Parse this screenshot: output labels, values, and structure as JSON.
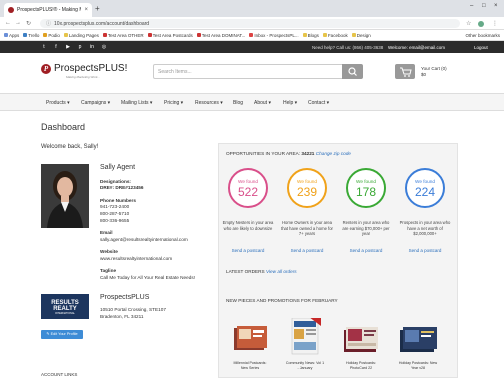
{
  "browser": {
    "tab_title": "ProspectsPLUS!® - Making Mark...",
    "url": "10x.prospectsplus.com/account/dashboard",
    "bookmarks": [
      "Apps",
      "Trello",
      "Podio",
      "Landing Pages",
      "Test Area OTHER",
      "Test Area Postcards",
      "Test Area DOMINAT...",
      "Inbox - ProspectsPL...",
      "Blogs",
      "Facebook",
      "Design"
    ],
    "other_bookmarks": "Other bookmarks"
  },
  "topbar": {
    "help_text": "Need help? Call us: (866) 405-3638",
    "welcome_text": "Welcome: email@email.com",
    "logout_label": "Logout"
  },
  "header": {
    "logo_mark": "P",
    "logo_text": "ProspectsPLUS!",
    "logo_tagline": "Making Marketing Work...",
    "search_placeholder": "Search Items...",
    "cart_label": "Your Cart (0)",
    "cart_total": "$0"
  },
  "nav": {
    "items": [
      "Products",
      "Campaigns",
      "Mailing Lists",
      "Pricing",
      "Resources",
      "Blog",
      "About",
      "Help",
      "Contact"
    ]
  },
  "dashboard": {
    "title": "Dashboard",
    "welcome": "Welcome back, Sally!",
    "agent": {
      "name": "Sally Agent",
      "designations_label": "Designations:",
      "dre": "DRE#: DRE#123456",
      "phone_label": "Phone Numbers",
      "phones": [
        "941-723-2400",
        "800-287-5710",
        "800-336-9655"
      ],
      "email_label": "Email",
      "email": "sally.agent@resultsrealtyinternational.com",
      "website_label": "Website",
      "website": "www.resultsrealtyinternational.com",
      "tagline_label": "Tagline",
      "tagline": "Call Me Today for All Your Real Estate Needs!"
    },
    "company": {
      "logo_text": "RESULTS REALTY",
      "logo_sub": "INTERNATIONAL",
      "edit_label": "Edit Your Profile",
      "name": "ProspectsPLUS",
      "address1": "10510 Portal Crossing, STE107",
      "address2": "Bradenton, FL 34211"
    },
    "account_links": "ACCOUNT LINKS"
  },
  "opportunities": {
    "header": "OPPORTUNITIES IN YOUR AREA:",
    "zip": "34221",
    "change_zip": "Change zip code",
    "cards": [
      {
        "found_label": "We found",
        "count": "522",
        "color": "#d94f8a",
        "desc": "Empty Nesters in your area who are likely to downsize",
        "link": "Send a postcard"
      },
      {
        "found_label": "We found",
        "count": "239",
        "color": "#f0a21a",
        "desc": "Home Owners in your area that have owned a home for 7+ years",
        "link": "Send a postcard"
      },
      {
        "found_label": "We found",
        "count": "178",
        "color": "#3aa935",
        "desc": "Renters in your area who are earning $70,000+ per year",
        "link": "Send a postcard"
      },
      {
        "found_label": "We found",
        "count": "224",
        "color": "#3b7dd8",
        "desc": "Prospects in your area who have a net worth of $2,000,000+",
        "link": "Send a postcard"
      }
    ],
    "latest_orders": "LATEST ORDERS",
    "view_all_orders": "View all orders",
    "new_pieces": "NEW PIECES AND PROMOTIONS FOR FEBRUARY",
    "promos": [
      {
        "caption": "Millennial Postcards: New Series"
      },
      {
        "caption": "Community News: Vol 1 - January"
      },
      {
        "caption": "Holiday Postcards: PhotoCard 22"
      },
      {
        "caption": "Holiday Postcards: New Year v28"
      }
    ]
  }
}
